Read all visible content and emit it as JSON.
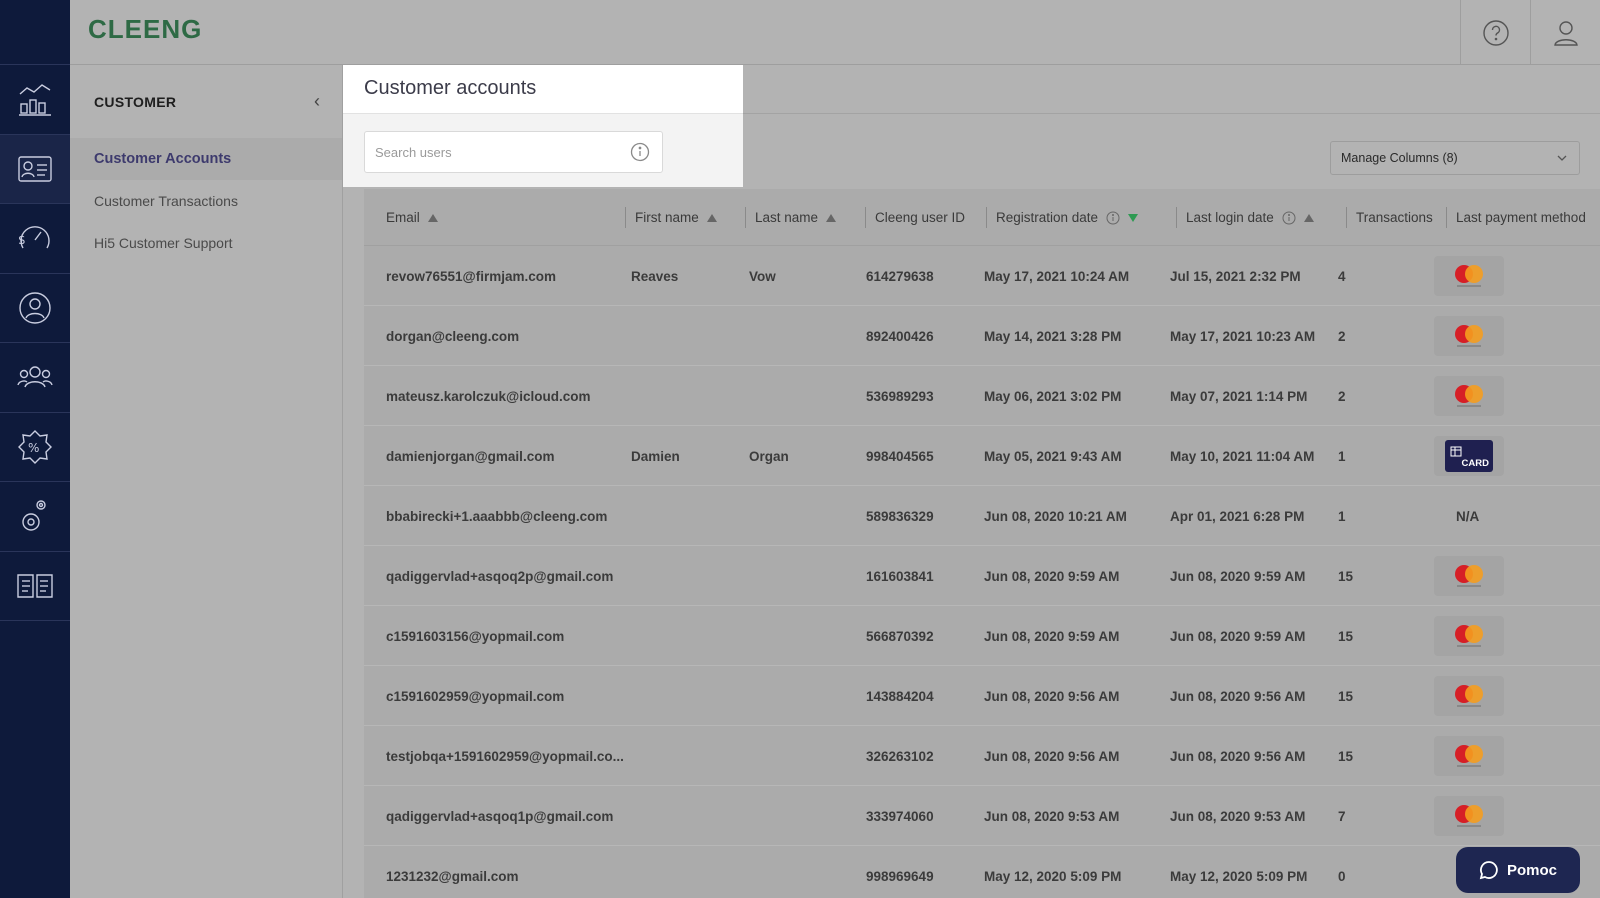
{
  "app": {
    "logo": "CLEENG"
  },
  "rail": {
    "items": [
      {
        "icon": "analytics-icon",
        "active": false
      },
      {
        "icon": "customer-card-icon",
        "active": true
      },
      {
        "icon": "revenue-gauge-icon",
        "active": false
      },
      {
        "icon": "user-refresh-icon",
        "active": false
      },
      {
        "icon": "users-group-icon",
        "active": false
      },
      {
        "icon": "discount-badge-icon",
        "active": false
      },
      {
        "icon": "settings-gears-icon",
        "active": false
      },
      {
        "icon": "documentation-book-icon",
        "active": false
      }
    ]
  },
  "topbar": {
    "help_icon": "help-circle-icon",
    "account_icon": "user-icon"
  },
  "subnav": {
    "title": "CUSTOMER",
    "items": [
      {
        "label": "Customer Accounts",
        "active": true
      },
      {
        "label": "Customer Transactions",
        "active": false
      },
      {
        "label": "Hi5 Customer Support",
        "active": false
      }
    ]
  },
  "page": {
    "title": "Customer accounts",
    "search_placeholder": "Search users",
    "manage_columns": "Manage Columns (8)"
  },
  "table": {
    "columns": [
      "Email",
      "First name",
      "Last name",
      "Cleeng user ID",
      "Registration date",
      "Last login date",
      "Transactions",
      "Last payment method"
    ],
    "rows": [
      {
        "email": "revow76551@firmjam.com",
        "first": "Reaves",
        "last": "Vow",
        "id": "614279638",
        "reg": "May 17, 2021 10:24 AM",
        "login": "Jul 15, 2021 2:32 PM",
        "tx": "4",
        "pay": "mastercard"
      },
      {
        "email": "dorgan@cleeng.com",
        "first": "",
        "last": "",
        "id": "892400426",
        "reg": "May 14, 2021 3:28 PM",
        "login": "May 17, 2021 10:23 AM",
        "tx": "2",
        "pay": "mastercard"
      },
      {
        "email": "mateusz.karolczuk@icloud.com",
        "first": "",
        "last": "",
        "id": "536989293",
        "reg": "May 06, 2021 3:02 PM",
        "login": "May 07, 2021 1:14 PM",
        "tx": "2",
        "pay": "mastercard"
      },
      {
        "email": "damienjorgan@gmail.com",
        "first": "Damien",
        "last": "Organ",
        "id": "998404565",
        "reg": "May 05, 2021 9:43 AM",
        "login": "May 10, 2021 11:04 AM",
        "tx": "1",
        "pay": "card"
      },
      {
        "email": "bbabirecki+1.aaabbb@cleeng.com",
        "first": "",
        "last": "",
        "id": "589836329",
        "reg": "Jun 08, 2020 10:21 AM",
        "login": "Apr 01, 2021 6:28 PM",
        "tx": "1",
        "pay": "N/A"
      },
      {
        "email": "qadiggervlad+asqoq2p@gmail.com",
        "first": "",
        "last": "",
        "id": "161603841",
        "reg": "Jun 08, 2020 9:59 AM",
        "login": "Jun 08, 2020 9:59 AM",
        "tx": "15",
        "pay": "mastercard"
      },
      {
        "email": "c1591603156@yopmail.com",
        "first": "",
        "last": "",
        "id": "566870392",
        "reg": "Jun 08, 2020 9:59 AM",
        "login": "Jun 08, 2020 9:59 AM",
        "tx": "15",
        "pay": "mastercard"
      },
      {
        "email": "c1591602959@yopmail.com",
        "first": "",
        "last": "",
        "id": "143884204",
        "reg": "Jun 08, 2020 9:56 AM",
        "login": "Jun 08, 2020 9:56 AM",
        "tx": "15",
        "pay": "mastercard"
      },
      {
        "email": "testjobqa+1591602959@yopmail.co...",
        "first": "",
        "last": "",
        "id": "326263102",
        "reg": "Jun 08, 2020 9:56 AM",
        "login": "Jun 08, 2020 9:56 AM",
        "tx": "15",
        "pay": "mastercard"
      },
      {
        "email": "qadiggervlad+asqoq1p@gmail.com",
        "first": "",
        "last": "",
        "id": "333974060",
        "reg": "Jun 08, 2020 9:53 AM",
        "login": "Jun 08, 2020 9:53 AM",
        "tx": "7",
        "pay": "mastercard"
      },
      {
        "email": "1231232@gmail.com",
        "first": "",
        "last": "",
        "id": "998969649",
        "reg": "May 12, 2020 5:09 PM",
        "login": "May 12, 2020 5:09 PM",
        "tx": "0",
        "pay": ""
      }
    ]
  },
  "card_label": "CARD",
  "help_button": "Pomoc",
  "colors": {
    "rail": "#0e1a3b",
    "accent": "#3d3a6d",
    "logo": "#2e6a45",
    "sort_active": "#2e9a52",
    "help_bg": "#1e2651"
  }
}
